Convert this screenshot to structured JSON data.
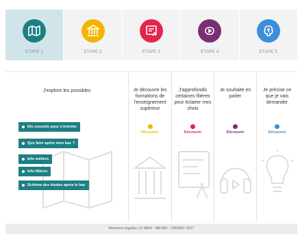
{
  "steps": [
    {
      "label": "ETAPE 1",
      "icon": "map-icon",
      "color": "#1e7f83"
    },
    {
      "label": "ETAPE 2",
      "icon": "building-icon",
      "color": "#f5b400"
    },
    {
      "label": "ETAPE 3",
      "icon": "screen-icon",
      "color": "#e4254c"
    },
    {
      "label": "ETAPE 4",
      "icon": "audio-icon",
      "color": "#7a2f73"
    },
    {
      "label": "ETAPE 5",
      "icon": "brain-icon",
      "color": "#3a8fd6"
    }
  ],
  "columns": {
    "explore": {
      "title": "J'explore les possibles",
      "links": [
        "Dis conseils pour s'orienter",
        "Que faire après mon bac ?",
        "Info métiers",
        "Info filières",
        "Schéma des études après le bac"
      ]
    },
    "formations": {
      "title": "Je découvre les formations de l'enseignement supérieur",
      "cta": "Découvrir",
      "color": "#f5b400"
    },
    "filieres": {
      "title": "J'approfondis certaines filières pour éclairer mes choix",
      "cta": "Découvrir",
      "color": "#e4254c"
    },
    "parler": {
      "title": "Je souhaite en parler",
      "cta": "Découvrir",
      "color": "#7a2f73"
    },
    "demander": {
      "title": "Je précise ce que je vais demander",
      "cta": "Découvrir",
      "color": "#3a8fd6"
    }
  },
  "footer": {
    "text": "Mentions légales | © MEN - MESRI - ONISEP 2017"
  }
}
